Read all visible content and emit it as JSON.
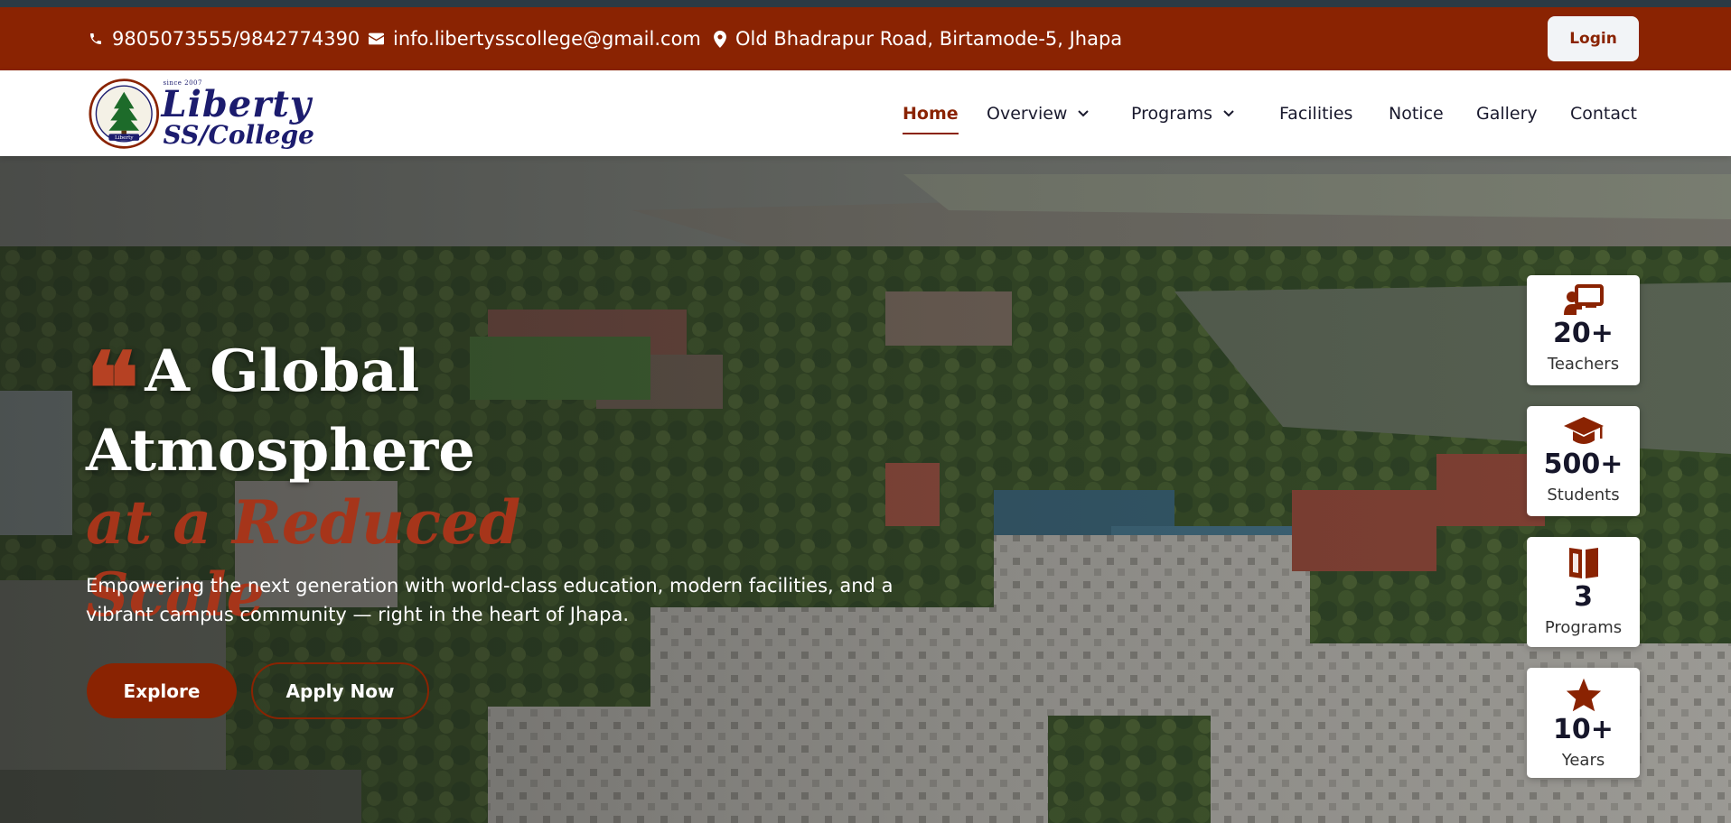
{
  "topbar": {
    "phone": "9805073555/9842774390",
    "email": "info.libertysscollege@gmail.com",
    "address": "Old Bhadrapur Road, Birtamode-5, Jhapa",
    "login_label": "Login",
    "icons": [
      "phone-icon",
      "envelope-icon",
      "map-pin-icon"
    ]
  },
  "logo": {
    "since": "since 2007",
    "line1": "Liberty",
    "line2": "SS/College",
    "emblem_text": "Liberty"
  },
  "nav": {
    "items": [
      {
        "label": "Home",
        "active": true
      },
      {
        "label": "Overview",
        "dropdown": true
      },
      {
        "label": "Programs",
        "dropdown": true
      },
      {
        "label": "Facilities"
      },
      {
        "label": "Notice"
      },
      {
        "label": "Gallery"
      },
      {
        "label": "Contact"
      }
    ]
  },
  "hero": {
    "quote_mark": "❝",
    "title_line1": "A Global",
    "title_line2": "Atmosphere",
    "title_line3": "at a Reduced Scale",
    "subtitle": "Empowering the next generation with world-class education, modern facilities, and a vibrant campus community — right in the heart of Jhapa.",
    "explore_label": "Explore",
    "apply_label": "Apply Now"
  },
  "stats": [
    {
      "icon": "teacher-board-icon",
      "value": "20+",
      "label": "Teachers"
    },
    {
      "icon": "graduation-cap-icon",
      "value": "500+",
      "label": "Students"
    },
    {
      "icon": "book-icon",
      "value": "3",
      "label": "Programs"
    },
    {
      "icon": "star-icon",
      "value": "10+",
      "label": "Years"
    }
  ],
  "colors": {
    "brand": "#8a2302",
    "accent_text": "#a6351a",
    "navy": "#1c1c6e"
  }
}
